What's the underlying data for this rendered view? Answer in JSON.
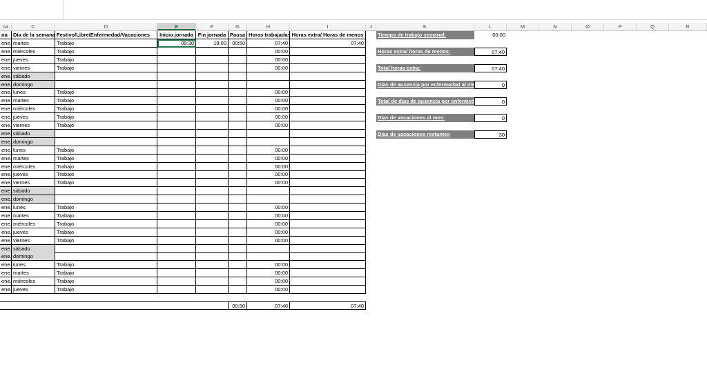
{
  "columns": [
    "na",
    "C",
    "D",
    "E",
    "F",
    "G",
    "H",
    "I",
    "J",
    "K",
    "L",
    "M",
    "N",
    "O",
    "P",
    "Q",
    "R"
  ],
  "headers": {
    "b": "na",
    "c": "Día de la semana",
    "d": "Festivo/Libre/Enfermedad/Vacaciones",
    "e": "Inicio jornada",
    "f": "Fin jornada",
    "g": "Pausa",
    "h": "Horas trabajadas",
    "i": "Horas extra/ Horas de menos"
  },
  "rows": [
    {
      "b": "ene.",
      "c": "martes",
      "d": "Trabajo",
      "e": "09:30",
      "f": "18:00",
      "g": "00:50",
      "h": "07:40",
      "i": "07:40",
      "w": false
    },
    {
      "b": "ene.",
      "c": "miércoles",
      "d": "Trabajo",
      "h": "00:00",
      "w": false
    },
    {
      "b": "ene.",
      "c": "jueves",
      "d": "Trabajo",
      "h": "00:00",
      "w": false
    },
    {
      "b": "ene.",
      "c": "viernes",
      "d": "Trabajo",
      "h": "00:00",
      "w": false
    },
    {
      "b": "ene.",
      "c": "sábado",
      "w": true
    },
    {
      "b": "ene.",
      "c": "domingo",
      "w": true
    },
    {
      "b": "ene.",
      "c": "lunes",
      "d": "Trabajo",
      "h": "00:00",
      "w": false
    },
    {
      "b": "ene.",
      "c": "martes",
      "d": "Trabajo",
      "h": "00:00",
      "w": false
    },
    {
      "b": "ene.",
      "c": "miércoles",
      "d": "Trabajo",
      "h": "00:00",
      "w": false
    },
    {
      "b": "ene.",
      "c": "jueves",
      "d": "Trabajo",
      "h": "00:00",
      "w": false
    },
    {
      "b": "ene.",
      "c": "viernes",
      "d": "Trabajo",
      "h": "00:00",
      "w": false
    },
    {
      "b": "ene.",
      "c": "sábado",
      "w": true
    },
    {
      "b": "ene.",
      "c": "domingo",
      "w": true
    },
    {
      "b": "ene.",
      "c": "lunes",
      "d": "Trabajo",
      "h": "00:00",
      "w": false
    },
    {
      "b": "ene.",
      "c": "martes",
      "d": "Trabajo",
      "h": "00:00",
      "w": false
    },
    {
      "b": "ene.",
      "c": "miércoles",
      "d": "Trabajo",
      "h": "00:00",
      "w": false
    },
    {
      "b": "ene.",
      "c": "jueves",
      "d": "Trabajo",
      "h": "00:00",
      "w": false
    },
    {
      "b": "ene.",
      "c": "viernes",
      "d": "Trabajo",
      "h": "00:00",
      "w": false
    },
    {
      "b": "ene.",
      "c": "sábado",
      "w": true
    },
    {
      "b": "ene.",
      "c": "domingo",
      "w": true
    },
    {
      "b": "ene.",
      "c": "lunes",
      "d": "Trabajo",
      "h": "00:00",
      "w": false
    },
    {
      "b": "ene.",
      "c": "martes",
      "d": "Trabajo",
      "h": "00:00",
      "w": false
    },
    {
      "b": "ene.",
      "c": "miércoles",
      "d": "Trabajo",
      "h": "00:00",
      "w": false
    },
    {
      "b": "ene.",
      "c": "jueves",
      "d": "Trabajo",
      "h": "00:00",
      "w": false
    },
    {
      "b": "ene.",
      "c": "viernes",
      "d": "Trabajo",
      "h": "00:00",
      "w": false
    },
    {
      "b": "ene.",
      "c": "sábado",
      "w": true
    },
    {
      "b": "ene.",
      "c": "domingo",
      "w": true
    },
    {
      "b": "ene.",
      "c": "lunes",
      "d": "Trabajo",
      "h": "00:00",
      "w": false
    },
    {
      "b": "ene.",
      "c": "martes",
      "d": "Trabajo",
      "h": "00:00",
      "w": false
    },
    {
      "b": "ene.",
      "c": "miércoles",
      "d": "Trabajo",
      "h": "00:00",
      "w": false
    },
    {
      "b": "ene.",
      "c": "jueves",
      "d": "Trabajo",
      "h": "00:00",
      "w": false
    }
  ],
  "totals": {
    "g": "00:50",
    "h": "07:40",
    "i": "07:40"
  },
  "summary": [
    {
      "label": "Tiempo de trabajo semanal:",
      "value": "00:00"
    },
    {
      "label": "Horas extra/ horas de menos:",
      "value": "07:40"
    },
    {
      "label": "Total  horas extra:",
      "value": "07:40"
    },
    {
      "label": "Días de ausencia por enfermedad al mes:",
      "value": "0"
    },
    {
      "label": "Total de días de ausencia por enfermedad:",
      "value": "0"
    },
    {
      "label": "Días de vacaciones al mes:",
      "value": "0"
    },
    {
      "label": "Días de vacaciones restantes",
      "value": "30"
    }
  ]
}
